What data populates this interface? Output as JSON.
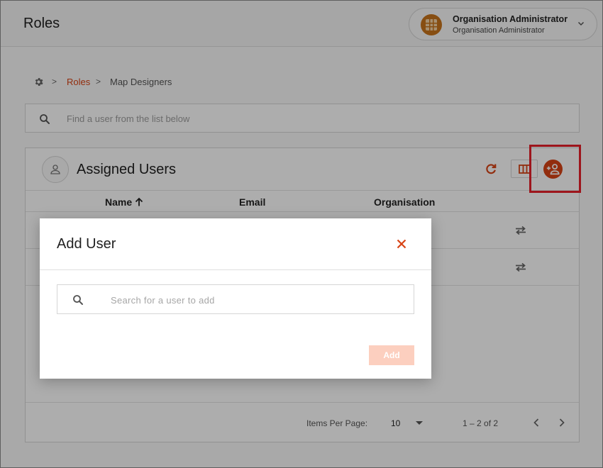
{
  "header": {
    "title": "Roles",
    "user": {
      "name": "Organisation Administrator",
      "role": "Organisation Administrator"
    }
  },
  "breadcrumb": {
    "separator": ">",
    "parent": "Roles",
    "current": "Map Designers"
  },
  "list_search": {
    "placeholder": "Find a user from the list below"
  },
  "card": {
    "title": "Assigned Users",
    "columns": [
      "Name",
      "Email",
      "Organisation"
    ],
    "rows": [
      {
        "name": "",
        "email": "",
        "organisation": ""
      },
      {
        "name": "",
        "email": "",
        "organisation": ""
      }
    ],
    "footer": {
      "items_per_page_label": "Items Per Page:",
      "items_per_page_value": "10",
      "range": "1 – 2 of 2"
    }
  },
  "dialog": {
    "title": "Add User",
    "search_placeholder": "Search for a user to add",
    "add_label": "Add"
  },
  "colors": {
    "accent": "#d84315",
    "highlight": "#e8202a",
    "add_disabled": "#fccfbf"
  }
}
